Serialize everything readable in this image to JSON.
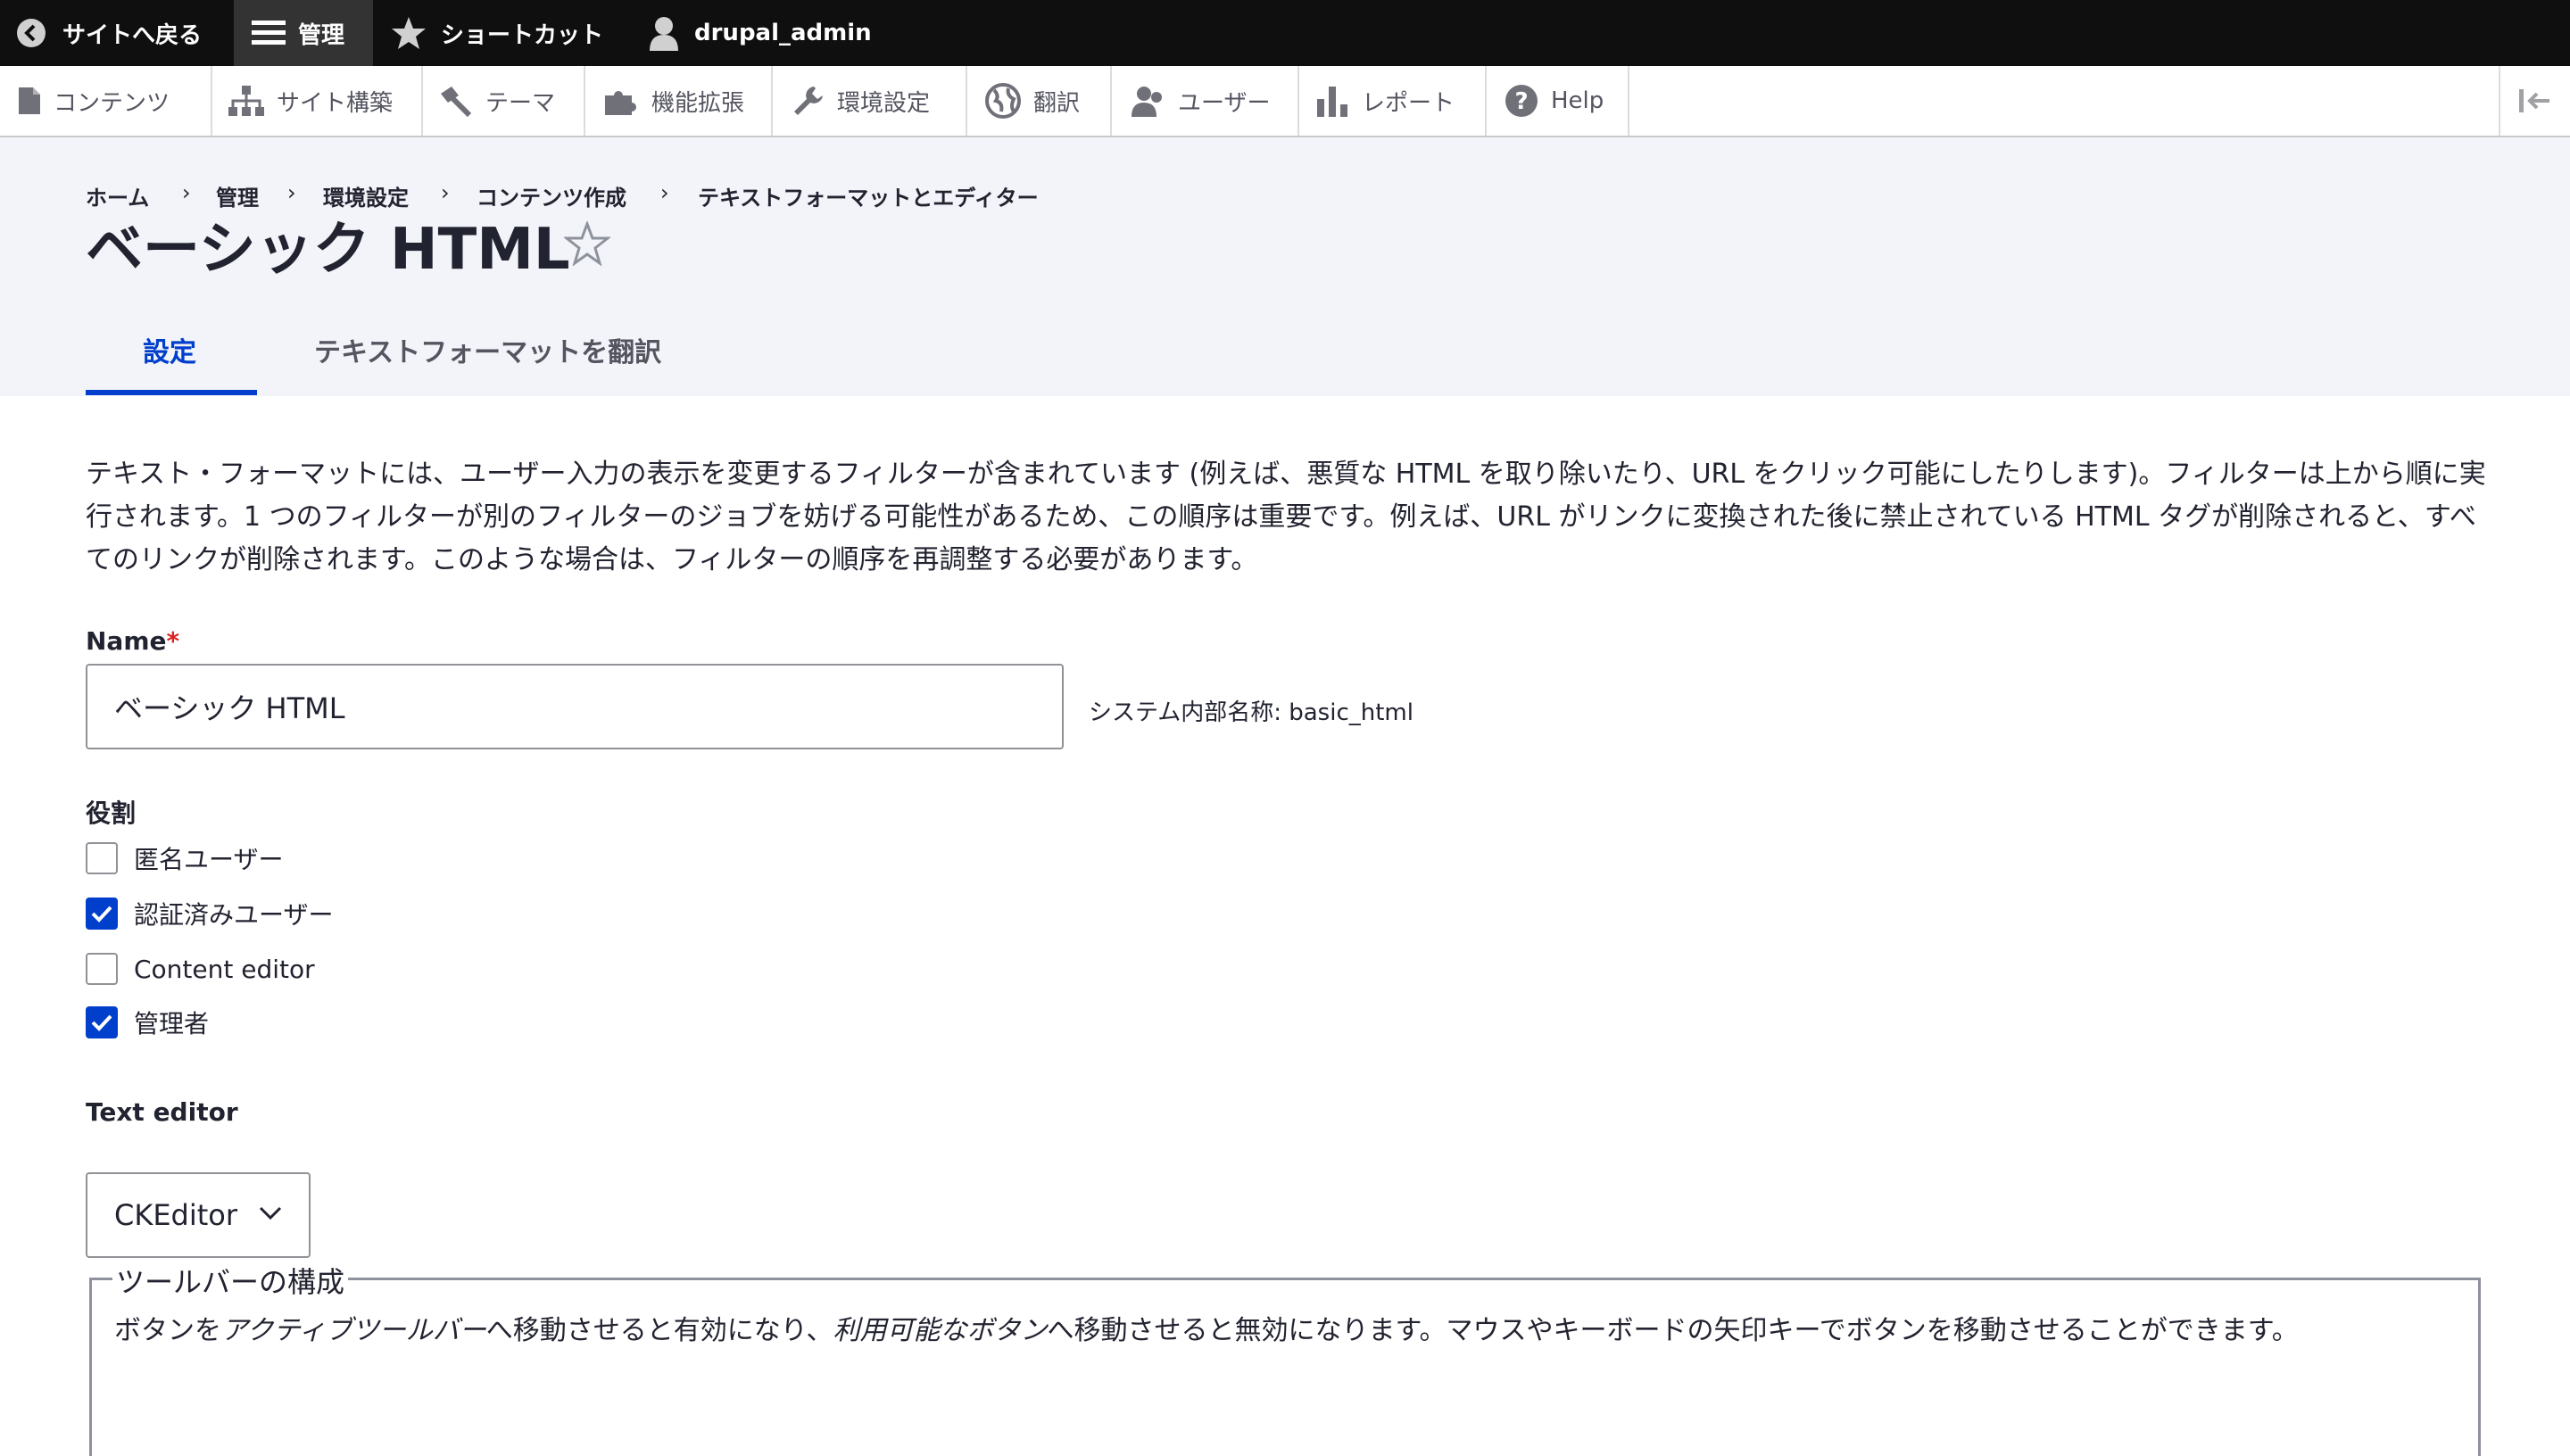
{
  "toolbar": {
    "back": "サイトへ戻る",
    "manage": "管理",
    "shortcuts": "ショートカット",
    "user": "drupal_admin"
  },
  "tray": {
    "items": [
      {
        "label": "コンテンツ",
        "icon": "file-icon"
      },
      {
        "label": "サイト構築",
        "icon": "structure-icon"
      },
      {
        "label": "テーマ",
        "icon": "paintbrush-icon"
      },
      {
        "label": "機能拡張",
        "icon": "puzzle-icon"
      },
      {
        "label": "環境設定",
        "icon": "wrench-icon"
      },
      {
        "label": "翻訳",
        "icon": "globe-icon"
      },
      {
        "label": "ユーザー",
        "icon": "people-icon"
      },
      {
        "label": "レポート",
        "icon": "bar-chart-icon"
      },
      {
        "label": "Help",
        "icon": "help-icon"
      }
    ]
  },
  "breadcrumb": {
    "items": [
      "ホーム",
      "管理",
      "環境設定",
      "コンテンツ作成",
      "テキストフォーマットとエディター"
    ],
    "separator": "›"
  },
  "page": {
    "title": "ベーシック HTML"
  },
  "tabs": {
    "settings": "設定",
    "translate": "テキストフォーマットを翻訳"
  },
  "description": "テキスト・フォーマットには、ユーザー入力の表示を変更するフィルターが含まれています (例えば、悪質な HTML を取り除いたり、URL をクリック可能にしたりします)。フィルターは上から順に実行されます。1 つのフィルターが別のフィルターのジョブを妨げる可能性があるため、この順序は重要です。例えば、URL がリンクに変換された後に禁止されている HTML タグが削除されると、すべてのリンクが削除されます。このような場合は、フィルターの順序を再調整する必要があります。",
  "form": {
    "name_label": "Name",
    "required_mark": "*",
    "name_value": "ベーシック HTML",
    "machine_name": "システム内部名称: basic_html",
    "roles_label": "役割",
    "roles": [
      {
        "label": "匿名ユーザー",
        "checked": false
      },
      {
        "label": "認証済みユーザー",
        "checked": true
      },
      {
        "label": "Content editor",
        "checked": false
      },
      {
        "label": "管理者",
        "checked": true
      }
    ],
    "editor_label": "Text editor",
    "editor_value": "CKEditor",
    "toolbar_legend": "ツールバーの構成",
    "toolbar_desc_1": "ボタンを",
    "toolbar_desc_em1": "アクティブツールバー",
    "toolbar_desc_2": "へ移動させると有効になり、",
    "toolbar_desc_em2": "利用可能なボタン",
    "toolbar_desc_3": "へ移動させると無効になります。マウスやキーボードの矢印キーでボタンを移動させることができます。"
  },
  "colors": {
    "accent": "#003ecc",
    "toolbar_bg": "#0f0f0f",
    "header_bg": "#f3f4f9",
    "required": "#dc2323"
  }
}
